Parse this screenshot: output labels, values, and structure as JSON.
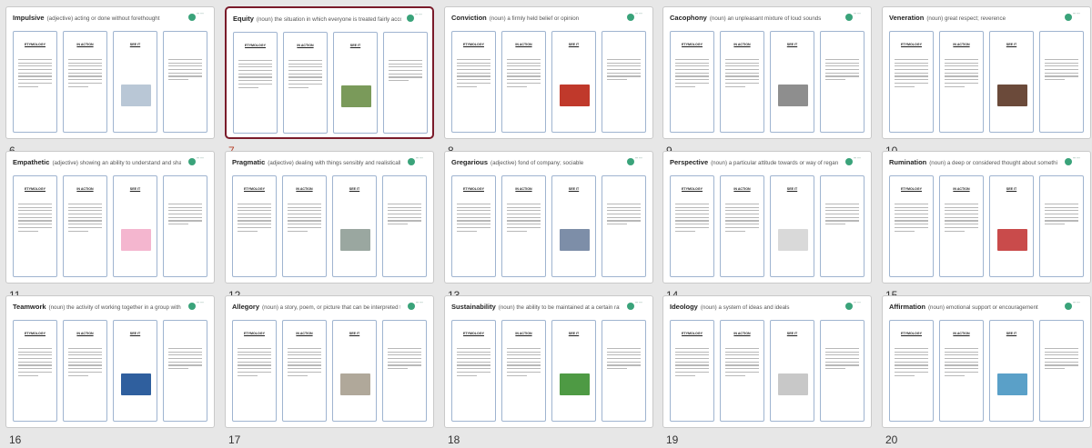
{
  "slides": [
    {
      "number": "6",
      "title": "Impulsive",
      "subtitle": "(adjective) acting or done without forethought",
      "cards": [
        "ETYMOLOGY",
        "IN ACTION",
        "SEE IT",
        ""
      ],
      "selected": false,
      "pic": "#b9c7d6"
    },
    {
      "number": "7",
      "title": "Equity",
      "subtitle": "(noun) the situation in which everyone is treated fairly according to their needs and no group of people is given special treatment",
      "cards": [
        "ETYMOLOGY",
        "IN ACTION",
        "SEE IT",
        ""
      ],
      "selected": true,
      "pic": "#7a9a5a"
    },
    {
      "number": "8",
      "title": "Conviction",
      "subtitle": "(noun) a firmly held belief or opinion",
      "cards": [
        "ETYMOLOGY",
        "IN ACTION",
        "SEE IT",
        ""
      ],
      "selected": false,
      "pic": "#c0392b"
    },
    {
      "number": "9",
      "title": "Cacophony",
      "subtitle": "(noun) an unpleasant mixture of loud sounds",
      "cards": [
        "ETYMOLOGY",
        "IN ACTION",
        "SEE IT",
        ""
      ],
      "selected": false,
      "pic": "#8e8e8e"
    },
    {
      "number": "10",
      "title": "Veneration",
      "subtitle": "(noun) great respect; reverence",
      "cards": [
        "ETYMOLOGY",
        "IN ACTION",
        "SEE IT",
        ""
      ],
      "selected": false,
      "pic": "#6b4a3a"
    },
    {
      "number": "11",
      "title": "Empathetic",
      "subtitle": "(adjective) showing an ability to understand and share the feelings of another",
      "cards": [
        "ETYMOLOGY",
        "IN ACTION",
        "SEE IT",
        ""
      ],
      "selected": false,
      "pic": "#f4b6cf"
    },
    {
      "number": "12",
      "title": "Pragmatic",
      "subtitle": "(adjective) dealing with things sensibly and realistically in a way that is based on practical rather than theoretical considerations",
      "cards": [
        "ETYMOLOGY",
        "IN ACTION",
        "SEE IT",
        ""
      ],
      "selected": false,
      "pic": "#9aa7a0"
    },
    {
      "number": "13",
      "title": "Gregarious",
      "subtitle": "(adjective) fond of company; sociable",
      "cards": [
        "ETYMOLOGY",
        "IN ACTION",
        "SEE IT",
        ""
      ],
      "selected": false,
      "pic": "#7d8ea8"
    },
    {
      "number": "14",
      "title": "Perspective",
      "subtitle": "(noun) a particular attitude towards or way of regarding something; a point of view",
      "cards": [
        "ETYMOLOGY",
        "IN ACTION",
        "SEE IT",
        ""
      ],
      "selected": false,
      "pic": "#d9d9d9"
    },
    {
      "number": "15",
      "title": "Rumination",
      "subtitle": "(noun) a deep or considered thought about something",
      "cards": [
        "ETYMOLOGY",
        "IN ACTION",
        "SEE IT",
        ""
      ],
      "selected": false,
      "pic": "#c94b4b"
    },
    {
      "number": "16",
      "title": "Teamwork",
      "subtitle": "(noun) the activity of working together in a group with other people",
      "cards": [
        "ETYMOLOGY",
        "IN ACTION",
        "SEE IT",
        ""
      ],
      "selected": false,
      "pic": "#2f5f9e"
    },
    {
      "number": "17",
      "title": "Allegory",
      "subtitle": "(noun) a story, poem, or picture that can be interpreted to reveal a hidden meaning",
      "cards": [
        "ETYMOLOGY",
        "IN ACTION",
        "SEE IT",
        ""
      ],
      "selected": false,
      "pic": "#b0a89a"
    },
    {
      "number": "18",
      "title": "Sustainability",
      "subtitle": "(noun) the ability to be maintained at a certain rate or level",
      "cards": [
        "ETYMOLOGY",
        "IN ACTION",
        "SEE IT",
        ""
      ],
      "selected": false,
      "pic": "#4e9a44"
    },
    {
      "number": "19",
      "title": "Ideology",
      "subtitle": "(noun) a system of ideas and ideals",
      "cards": [
        "ETYMOLOGY",
        "IN ACTION",
        "SEE IT",
        ""
      ],
      "selected": false,
      "pic": "#c8c8c8"
    },
    {
      "number": "20",
      "title": "Affirmation",
      "subtitle": "(noun) emotional support or encouragement",
      "cards": [
        "ETYMOLOGY",
        "IN ACTION",
        "SEE IT",
        ""
      ],
      "selected": false,
      "pic": "#5aa0c8"
    }
  ]
}
